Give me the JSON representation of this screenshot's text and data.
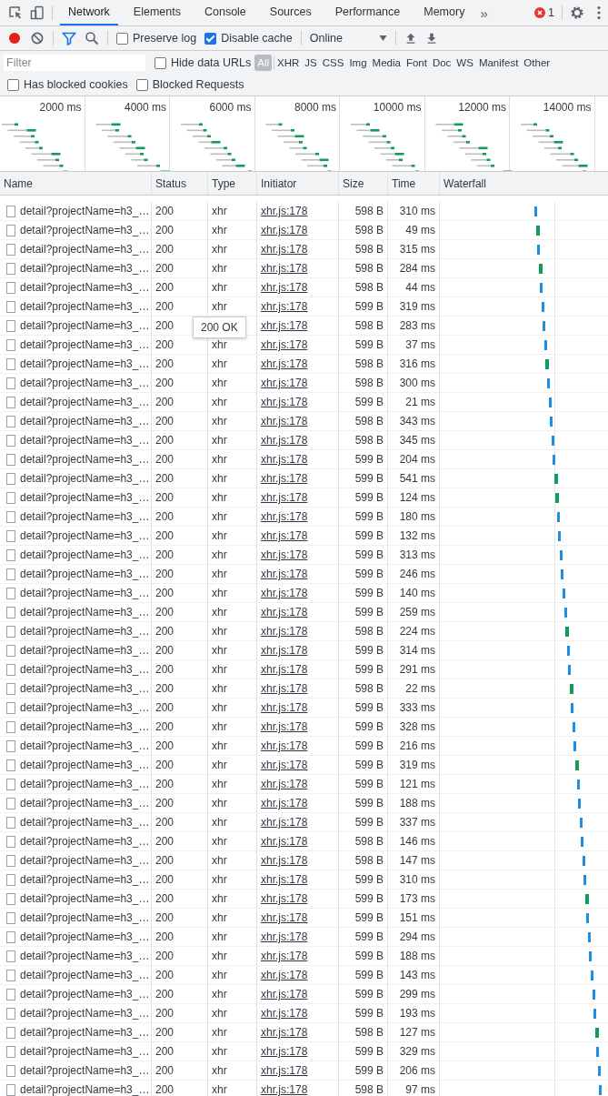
{
  "tabs": [
    {
      "label": "Network",
      "selected": true
    },
    {
      "label": "Elements",
      "selected": false
    },
    {
      "label": "Console",
      "selected": false
    },
    {
      "label": "Sources",
      "selected": false
    },
    {
      "label": "Performance",
      "selected": false
    },
    {
      "label": "Memory",
      "selected": false
    }
  ],
  "more_tabs": "»",
  "error_count": "1",
  "toolbar": {
    "recording": true,
    "filter_on": true,
    "preserve_log": {
      "label": "Preserve log",
      "checked": false
    },
    "disable_cache": {
      "label": "Disable cache",
      "checked": true
    },
    "throttling": "Online"
  },
  "filter_bar": {
    "placeholder": "Filter",
    "hide_data_urls": {
      "label": "Hide data URLs",
      "checked": false
    },
    "types": [
      {
        "label": "All",
        "selected": true
      },
      {
        "label": "XHR",
        "selected": false
      },
      {
        "label": "JS",
        "selected": false
      },
      {
        "label": "CSS",
        "selected": false
      },
      {
        "label": "Img",
        "selected": false
      },
      {
        "label": "Media",
        "selected": false
      },
      {
        "label": "Font",
        "selected": false
      },
      {
        "label": "Doc",
        "selected": false
      },
      {
        "label": "WS",
        "selected": false
      },
      {
        "label": "Manifest",
        "selected": false
      },
      {
        "label": "Other",
        "selected": false
      }
    ],
    "has_blocked_cookies": {
      "label": "Has blocked cookies",
      "checked": false
    },
    "blocked_requests": {
      "label": "Blocked Requests",
      "checked": false
    }
  },
  "overview": {
    "ticks": [
      "2000 ms",
      "4000 ms",
      "6000 ms",
      "8000 ms",
      "10000 ms",
      "12000 ms",
      "14000 ms"
    ]
  },
  "table": {
    "columns": [
      "Name",
      "Status",
      "Type",
      "Initiator",
      "Size",
      "Time",
      "Waterfall"
    ],
    "rows": [
      {
        "name": "detail?projectName=h3_…",
        "status": "200",
        "type": "xhr",
        "initiator": "xhr.js:178",
        "size": "598 B",
        "time": "310 ms"
      },
      {
        "name": "detail?projectName=h3_…",
        "status": "200",
        "type": "xhr",
        "initiator": "xhr.js:178",
        "size": "598 B",
        "time": "49 ms"
      },
      {
        "name": "detail?projectName=h3_…",
        "status": "200",
        "type": "xhr",
        "initiator": "xhr.js:178",
        "size": "598 B",
        "time": "315 ms"
      },
      {
        "name": "detail?projectName=h3_…",
        "status": "200",
        "type": "xhr",
        "initiator": "xhr.js:178",
        "size": "598 B",
        "time": "284 ms"
      },
      {
        "name": "detail?projectName=h3_…",
        "status": "200",
        "type": "xhr",
        "initiator": "xhr.js:178",
        "size": "598 B",
        "time": "44 ms"
      },
      {
        "name": "detail?projectName=h3_…",
        "status": "200",
        "type": "xhr",
        "initiator": "xhr.js:178",
        "size": "599 B",
        "time": "319 ms"
      },
      {
        "name": "detail?projectName=h3_…",
        "status": "200",
        "initiator": "xhr.js:178",
        "size": "598 B",
        "time": "283 ms"
      },
      {
        "name": "detail?projectName=h3_…",
        "status": "200",
        "type": "xhr",
        "initiator": "xhr.js:178",
        "size": "599 B",
        "time": "37 ms"
      },
      {
        "name": "detail?projectName=h3_…",
        "status": "200",
        "type": "xhr",
        "initiator": "xhr.js:178",
        "size": "598 B",
        "time": "316 ms"
      },
      {
        "name": "detail?projectName=h3_…",
        "status": "200",
        "type": "xhr",
        "initiator": "xhr.js:178",
        "size": "598 B",
        "time": "300 ms"
      },
      {
        "name": "detail?projectName=h3_…",
        "status": "200",
        "type": "xhr",
        "initiator": "xhr.js:178",
        "size": "599 B",
        "time": "21 ms"
      },
      {
        "name": "detail?projectName=h3_…",
        "status": "200",
        "type": "xhr",
        "initiator": "xhr.js:178",
        "size": "598 B",
        "time": "343 ms"
      },
      {
        "name": "detail?projectName=h3_…",
        "status": "200",
        "type": "xhr",
        "initiator": "xhr.js:178",
        "size": "598 B",
        "time": "345 ms"
      },
      {
        "name": "detail?projectName=h3_…",
        "status": "200",
        "type": "xhr",
        "initiator": "xhr.js:178",
        "size": "599 B",
        "time": "204 ms"
      },
      {
        "name": "detail?projectName=h3_…",
        "status": "200",
        "type": "xhr",
        "initiator": "xhr.js:178",
        "size": "599 B",
        "time": "541 ms"
      },
      {
        "name": "detail?projectName=h3_…",
        "status": "200",
        "type": "xhr",
        "initiator": "xhr.js:178",
        "size": "599 B",
        "time": "124 ms"
      },
      {
        "name": "detail?projectName=h3_…",
        "status": "200",
        "type": "xhr",
        "initiator": "xhr.js:178",
        "size": "599 B",
        "time": "180 ms"
      },
      {
        "name": "detail?projectName=h3_…",
        "status": "200",
        "type": "xhr",
        "initiator": "xhr.js:178",
        "size": "599 B",
        "time": "132 ms"
      },
      {
        "name": "detail?projectName=h3_…",
        "status": "200",
        "type": "xhr",
        "initiator": "xhr.js:178",
        "size": "599 B",
        "time": "313 ms"
      },
      {
        "name": "detail?projectName=h3_…",
        "status": "200",
        "type": "xhr",
        "initiator": "xhr.js:178",
        "size": "599 B",
        "time": "246 ms"
      },
      {
        "name": "detail?projectName=h3_…",
        "status": "200",
        "type": "xhr",
        "initiator": "xhr.js:178",
        "size": "599 B",
        "time": "140 ms"
      },
      {
        "name": "detail?projectName=h3_…",
        "status": "200",
        "type": "xhr",
        "initiator": "xhr.js:178",
        "size": "599 B",
        "time": "259 ms"
      },
      {
        "name": "detail?projectName=h3_…",
        "status": "200",
        "type": "xhr",
        "initiator": "xhr.js:178",
        "size": "598 B",
        "time": "224 ms"
      },
      {
        "name": "detail?projectName=h3_…",
        "status": "200",
        "type": "xhr",
        "initiator": "xhr.js:178",
        "size": "599 B",
        "time": "314 ms"
      },
      {
        "name": "detail?projectName=h3_…",
        "status": "200",
        "type": "xhr",
        "initiator": "xhr.js:178",
        "size": "599 B",
        "time": "291 ms"
      },
      {
        "name": "detail?projectName=h3_…",
        "status": "200",
        "type": "xhr",
        "initiator": "xhr.js:178",
        "size": "598 B",
        "time": "22 ms"
      },
      {
        "name": "detail?projectName=h3_…",
        "status": "200",
        "type": "xhr",
        "initiator": "xhr.js:178",
        "size": "599 B",
        "time": "333 ms"
      },
      {
        "name": "detail?projectName=h3_…",
        "status": "200",
        "type": "xhr",
        "initiator": "xhr.js:178",
        "size": "599 B",
        "time": "328 ms"
      },
      {
        "name": "detail?projectName=h3_…",
        "status": "200",
        "type": "xhr",
        "initiator": "xhr.js:178",
        "size": "599 B",
        "time": "216 ms"
      },
      {
        "name": "detail?projectName=h3_…",
        "status": "200",
        "type": "xhr",
        "initiator": "xhr.js:178",
        "size": "599 B",
        "time": "319 ms"
      },
      {
        "name": "detail?projectName=h3_…",
        "status": "200",
        "type": "xhr",
        "initiator": "xhr.js:178",
        "size": "599 B",
        "time": "121 ms"
      },
      {
        "name": "detail?projectName=h3_…",
        "status": "200",
        "type": "xhr",
        "initiator": "xhr.js:178",
        "size": "599 B",
        "time": "188 ms"
      },
      {
        "name": "detail?projectName=h3_…",
        "status": "200",
        "type": "xhr",
        "initiator": "xhr.js:178",
        "size": "599 B",
        "time": "337 ms"
      },
      {
        "name": "detail?projectName=h3_…",
        "status": "200",
        "type": "xhr",
        "initiator": "xhr.js:178",
        "size": "598 B",
        "time": "146 ms"
      },
      {
        "name": "detail?projectName=h3_…",
        "status": "200",
        "type": "xhr",
        "initiator": "xhr.js:178",
        "size": "598 B",
        "time": "147 ms"
      },
      {
        "name": "detail?projectName=h3_…",
        "status": "200",
        "type": "xhr",
        "initiator": "xhr.js:178",
        "size": "599 B",
        "time": "310 ms"
      },
      {
        "name": "detail?projectName=h3_…",
        "status": "200",
        "type": "xhr",
        "initiator": "xhr.js:178",
        "size": "599 B",
        "time": "173 ms"
      },
      {
        "name": "detail?projectName=h3_…",
        "status": "200",
        "type": "xhr",
        "initiator": "xhr.js:178",
        "size": "599 B",
        "time": "151 ms"
      },
      {
        "name": "detail?projectName=h3_…",
        "status": "200",
        "type": "xhr",
        "initiator": "xhr.js:178",
        "size": "599 B",
        "time": "294 ms"
      },
      {
        "name": "detail?projectName=h3_…",
        "status": "200",
        "type": "xhr",
        "initiator": "xhr.js:178",
        "size": "599 B",
        "time": "188 ms"
      },
      {
        "name": "detail?projectName=h3_…",
        "status": "200",
        "type": "xhr",
        "initiator": "xhr.js:178",
        "size": "599 B",
        "time": "143 ms"
      },
      {
        "name": "detail?projectName=h3_…",
        "status": "200",
        "type": "xhr",
        "initiator": "xhr.js:178",
        "size": "599 B",
        "time": "299 ms"
      },
      {
        "name": "detail?projectName=h3_…",
        "status": "200",
        "type": "xhr",
        "initiator": "xhr.js:178",
        "size": "599 B",
        "time": "193 ms"
      },
      {
        "name": "detail?projectName=h3_…",
        "status": "200",
        "type": "xhr",
        "initiator": "xhr.js:178",
        "size": "598 B",
        "time": "127 ms"
      },
      {
        "name": "detail?projectName=h3_…",
        "status": "200",
        "type": "xhr",
        "initiator": "xhr.js:178",
        "size": "599 B",
        "time": "329 ms"
      },
      {
        "name": "detail?projectName=h3_…",
        "status": "200",
        "type": "xhr",
        "initiator": "xhr.js:178",
        "size": "599 B",
        "time": "206 ms"
      },
      {
        "name": "detail?projectName=h3_…",
        "status": "200",
        "type": "xhr",
        "initiator": "xhr.js:178",
        "size": "598 B",
        "time": "97 ms"
      }
    ]
  },
  "tooltip": "200 OK"
}
